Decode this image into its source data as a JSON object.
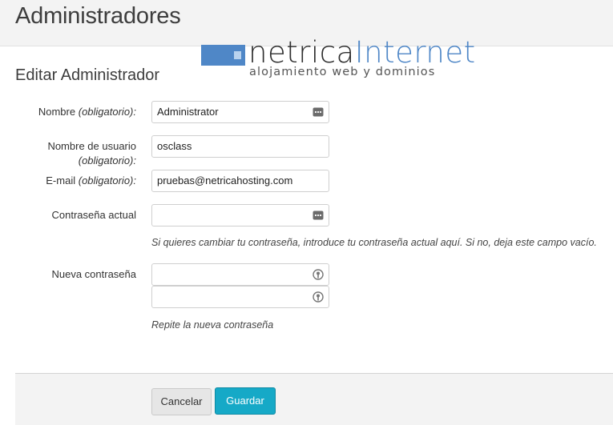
{
  "header": {
    "title": "Administradores"
  },
  "logo": {
    "name_part1": "netrica",
    "name_part2": "Internet",
    "tagline": "alojamiento web y dominios"
  },
  "section": {
    "title": "Editar Administrador"
  },
  "form": {
    "nombre": {
      "label": "Nombre",
      "required": "(obligatorio):",
      "value": "Administrator",
      "icon": "password-manager-icon"
    },
    "usuario": {
      "label": "Nombre de usuario",
      "required": "(obligatorio):",
      "value": "osclass"
    },
    "email": {
      "label": "E-mail",
      "required": "(obligatorio):",
      "value": "pruebas@netricahosting.com"
    },
    "password_actual": {
      "label": "Contraseña actual",
      "value": "",
      "icon": "password-manager-icon",
      "help": "Si quieres cambiar tu contraseña, introduce tu contraseña actual aquí. Si no, deja este campo vacío."
    },
    "password_nueva": {
      "label": "Nueva contraseña",
      "value": "",
      "repeat_value": "",
      "icon": "key-icon",
      "help": "Repite la nueva contraseña"
    }
  },
  "actions": {
    "cancel_label": "Cancelar",
    "save_label": "Guardar"
  },
  "colors": {
    "accent": "#16a9c7",
    "brand_blue": "#4f87c7"
  }
}
